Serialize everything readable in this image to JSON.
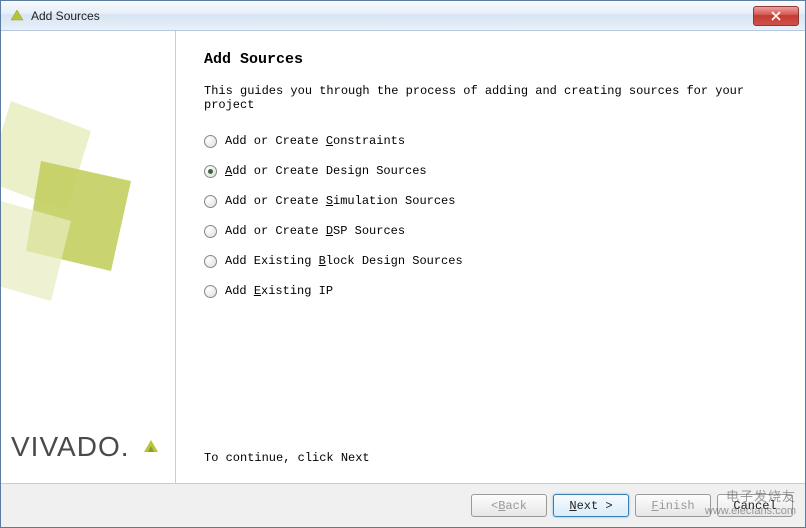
{
  "window": {
    "title": "Add Sources"
  },
  "page": {
    "heading": "Add Sources",
    "description": "This guides you through the process of adding and creating sources for your project",
    "footer_hint": "To continue, click Next"
  },
  "options": [
    {
      "pre": "Add or Create ",
      "mn": "C",
      "post": "onstraints",
      "selected": false
    },
    {
      "pre": "",
      "mn": "A",
      "post": "dd or Create Design Sources",
      "selected": true
    },
    {
      "pre": "Add or Create ",
      "mn": "S",
      "post": "imulation Sources",
      "selected": false
    },
    {
      "pre": "Add or Create ",
      "mn": "D",
      "post": "SP Sources",
      "selected": false
    },
    {
      "pre": "Add Existing ",
      "mn": "B",
      "post": "lock Design Sources",
      "selected": false
    },
    {
      "pre": "Add ",
      "mn": "E",
      "post": "xisting IP",
      "selected": false
    }
  ],
  "buttons": {
    "back": {
      "lt": "< ",
      "mn": "B",
      "rest": "ack",
      "enabled": false
    },
    "next": {
      "mn": "N",
      "rest": "ext >",
      "enabled": true,
      "primary": true
    },
    "finish": {
      "pre": "",
      "mn": "F",
      "rest": "inish",
      "enabled": false
    },
    "cancel": {
      "label": "Cancel",
      "enabled": true
    }
  },
  "branding": {
    "logo_text": "VIVADO."
  },
  "colors": {
    "accent_green": "#b7c43a",
    "accent_green_dark": "#8e9a2d",
    "close_red": "#c43c31"
  },
  "watermark": {
    "line1": "电子发烧友",
    "line2": "www.elecfans.com"
  }
}
